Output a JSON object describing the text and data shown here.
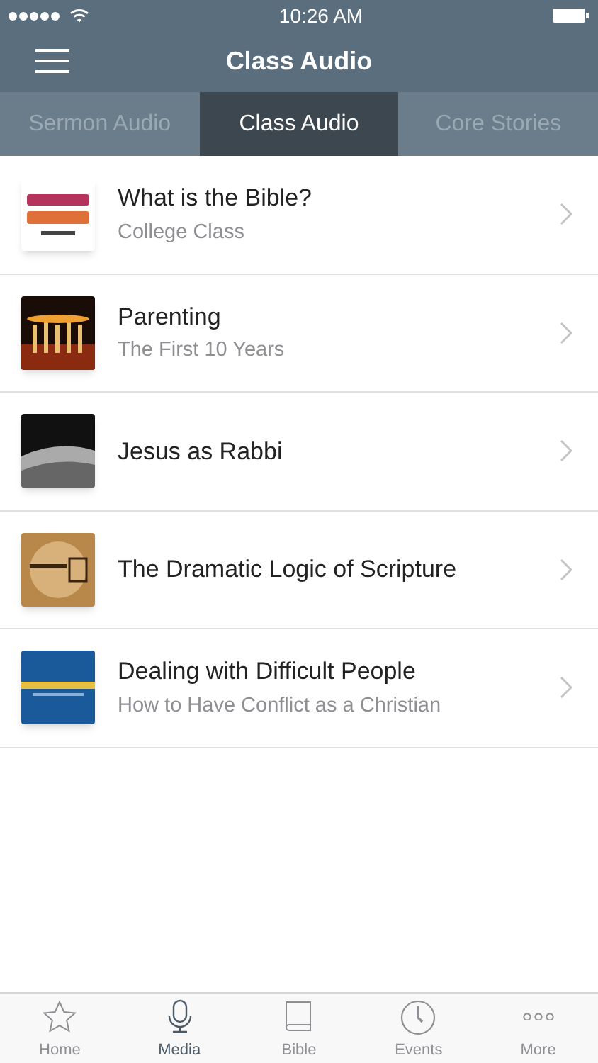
{
  "status_bar": {
    "time": "10:26 AM"
  },
  "nav_bar": {
    "title": "Class Audio"
  },
  "tabs": [
    {
      "label": "Sermon Audio",
      "selected": false
    },
    {
      "label": "Class Audio",
      "selected": true
    },
    {
      "label": "Core Stories",
      "selected": false
    }
  ],
  "items": [
    {
      "title": "What is the Bible?",
      "subtitle": "College Class"
    },
    {
      "title": "Parenting",
      "subtitle": "The First 10 Years"
    },
    {
      "title": "Jesus as Rabbi"
    },
    {
      "title": "The Dramatic Logic of Scripture"
    },
    {
      "title": "Dealing with Difficult People",
      "subtitle": "How to Have Conflict as a Christian"
    }
  ],
  "tab_bar": [
    {
      "label": "Home",
      "selected": false
    },
    {
      "label": "Media",
      "selected": true
    },
    {
      "label": "Bible",
      "selected": false
    },
    {
      "label": "Events",
      "selected": false
    },
    {
      "label": "More",
      "selected": false
    }
  ]
}
